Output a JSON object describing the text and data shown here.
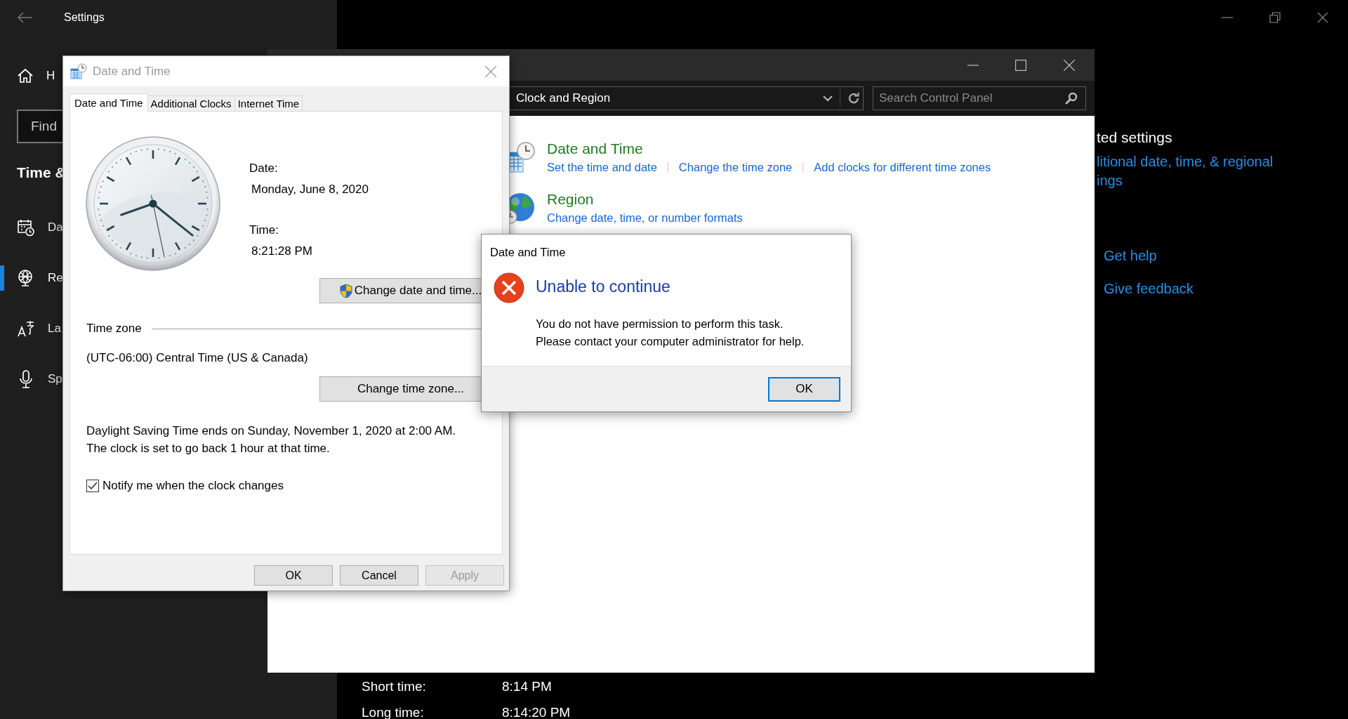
{
  "settings": {
    "title": "Settings",
    "home": {
      "label": "H"
    },
    "search": {
      "placeholder": "Find"
    },
    "section_title": "Time &",
    "nav": [
      {
        "kind": "calendar",
        "label": "Da",
        "selected": false
      },
      {
        "kind": "globe",
        "label": "Re",
        "selected": true
      },
      {
        "kind": "language",
        "label": "La",
        "selected": false
      },
      {
        "kind": "mic",
        "label": "Sp",
        "selected": false
      }
    ],
    "related": {
      "heading": "ted settings",
      "link_lines": [
        "litional date, time, & regional",
        "ings"
      ]
    },
    "help_links": [
      "Get help",
      "Give feedback"
    ],
    "formats": [
      {
        "label": "Short time:",
        "value": "8:14 PM"
      },
      {
        "label": "Long time:",
        "value": "8:14:20 PM"
      }
    ]
  },
  "control_panel": {
    "address": "Clock and Region",
    "search": {
      "placeholder": "Search Control Panel"
    },
    "categories": [
      {
        "kind": "datetime",
        "title": "Date and Time",
        "links": [
          "Set the time and date",
          "Change the time zone",
          "Add clocks for different time zones"
        ]
      },
      {
        "kind": "region",
        "title": "Region",
        "links": [
          "Change date, time, or number formats"
        ]
      }
    ]
  },
  "date_time_dialog": {
    "title": "Date and Time",
    "active": false,
    "tabs": [
      {
        "label": "Date and Time",
        "selected": true
      },
      {
        "label": "Additional Clocks",
        "selected": false
      },
      {
        "label": "Internet Time",
        "selected": false
      }
    ],
    "date_label": "Date:",
    "date": "Monday, June 8, 2020",
    "time_label": "Time:",
    "time": "8:21:28 PM",
    "change_datetime_button": "Change date and time...",
    "time_zone_heading": "Time zone",
    "time_zone": "(UTC-06:00) Central Time (US & Canada)",
    "change_zone_button": "Change time zone...",
    "dst_note": [
      "Daylight Saving Time ends on Sunday, November 1, 2020 at 2:00 AM.",
      "The clock is set to go back 1 hour at that time."
    ],
    "notify": {
      "label": "Notify me when the clock changes",
      "checked": true
    },
    "buttons": [
      {
        "label": "OK",
        "disabled": false
      },
      {
        "label": "Cancel",
        "disabled": false
      },
      {
        "label": "Apply",
        "disabled": true
      }
    ]
  },
  "error_dialog": {
    "title": "Date and Time",
    "heading": "Unable to continue",
    "message": [
      "You do not have permission to perform this task.",
      "Please contact your computer administrator for help."
    ],
    "button": "OK"
  }
}
